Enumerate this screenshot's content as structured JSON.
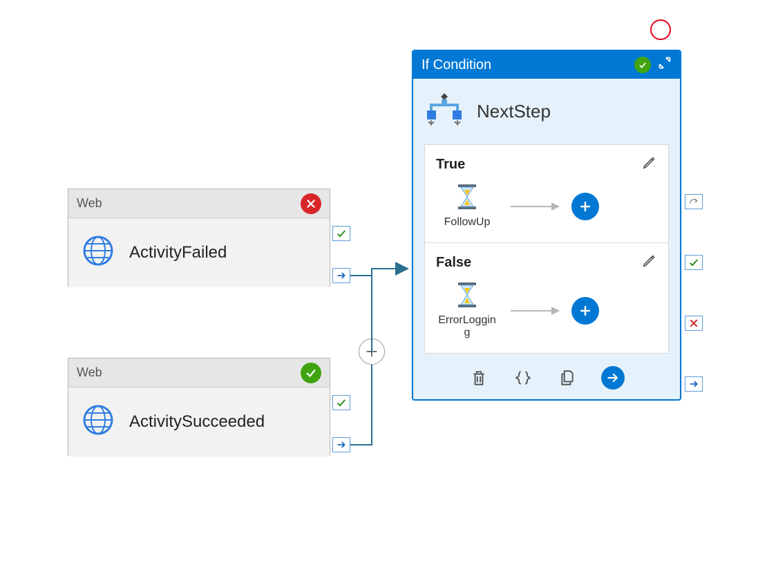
{
  "activities": [
    {
      "type_label": "Web",
      "name": "ActivityFailed",
      "status": "fail"
    },
    {
      "type_label": "Web",
      "name": "ActivitySucceeded",
      "status": "ok"
    }
  ],
  "condition": {
    "title": "If Condition",
    "name": "NextStep",
    "status": "ok",
    "branches": [
      {
        "label": "True",
        "activity_name": "FollowUp"
      },
      {
        "label": "False",
        "activity_name": "ErrorLogging"
      }
    ]
  }
}
